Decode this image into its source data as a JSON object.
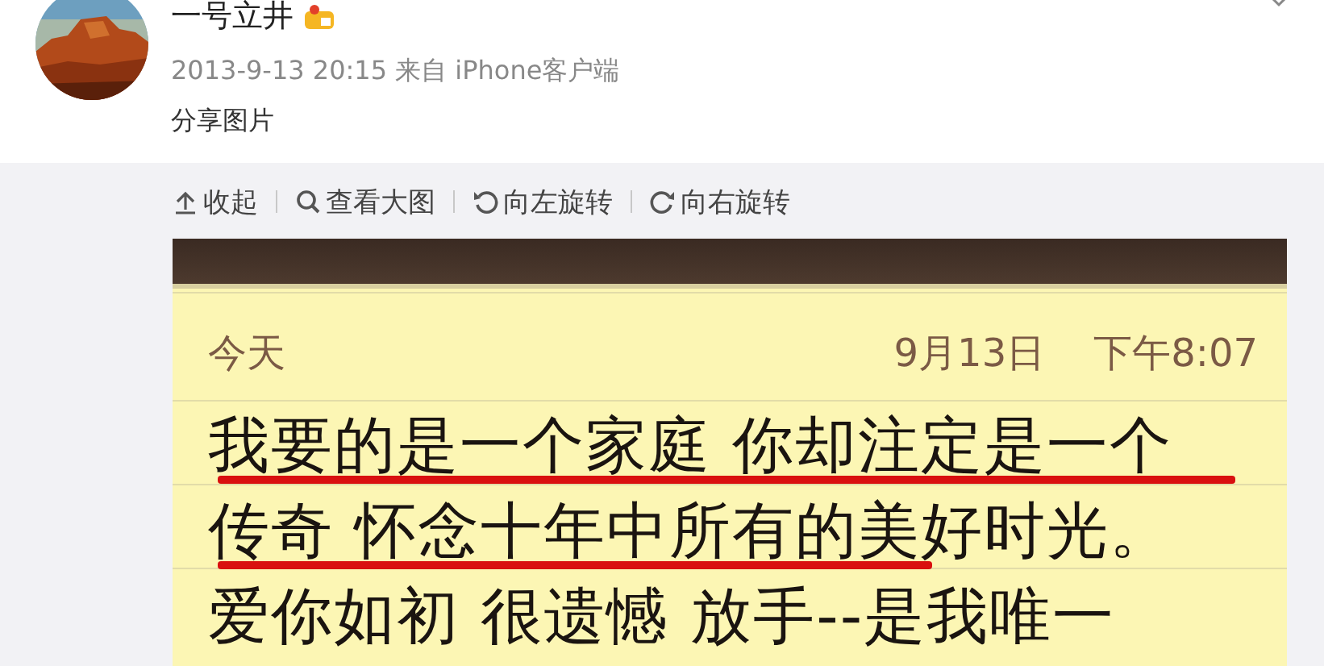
{
  "post": {
    "author": "一号立井",
    "meta": "2013-9-13 20:15 来自 iPhone客户端",
    "text": "分享图片"
  },
  "actions": [
    {
      "kind": "collapse",
      "label": "收起"
    },
    {
      "kind": "zoom",
      "label": "查看大图"
    },
    {
      "kind": "rotate-left",
      "label": "向左旋转"
    },
    {
      "kind": "rotate-right",
      "label": "向右旋转"
    }
  ],
  "note": {
    "day": "今天",
    "date": "9月13日",
    "time": "下午8:07",
    "lines": [
      {
        "text": "我要的是一个家庭 你却注定是一个",
        "kind": "underlined"
      },
      {
        "text": "传奇 怀念十年中所有的美好时光。",
        "kind": "partly-underlined"
      },
      {
        "text": "爱你如初 很遗憾 放手--是我唯一",
        "kind": "plain"
      }
    ]
  }
}
